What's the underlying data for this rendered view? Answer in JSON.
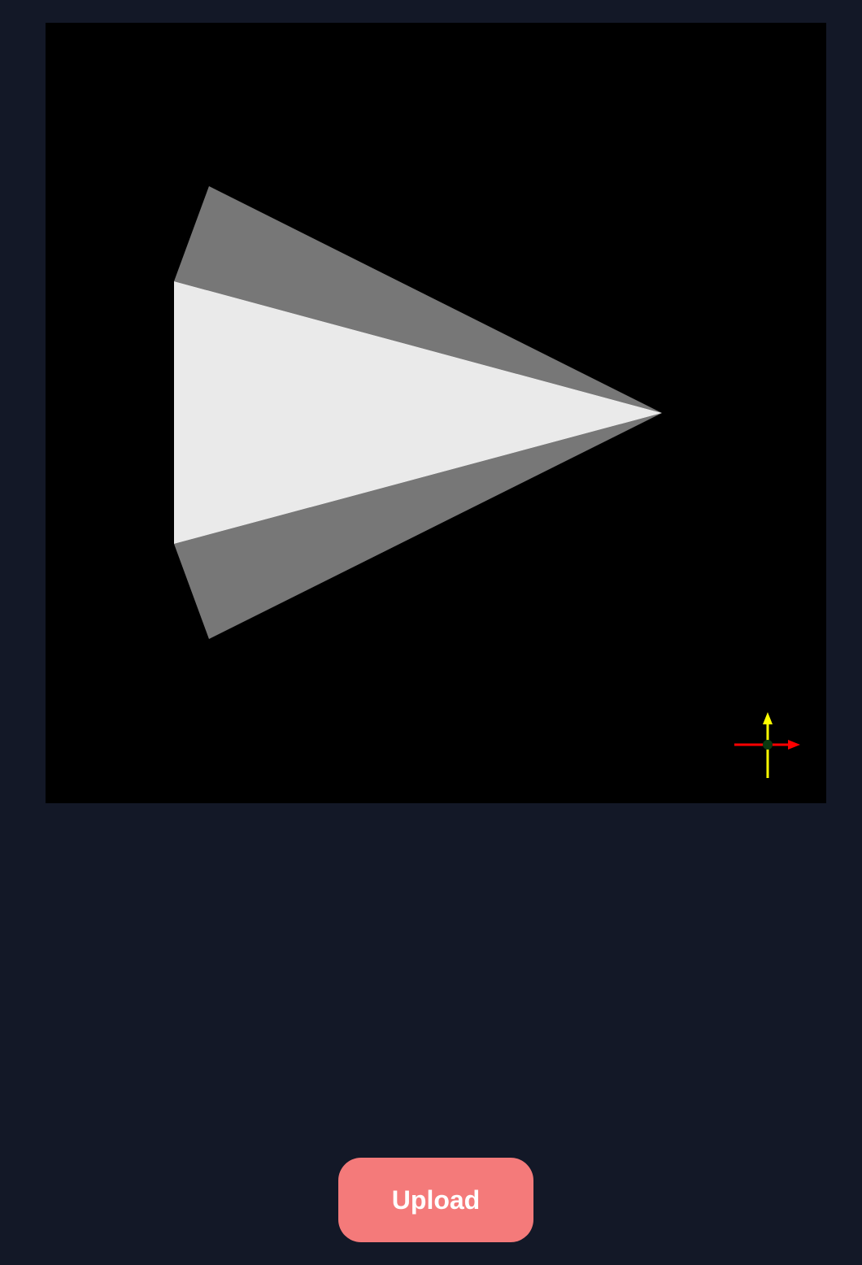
{
  "viewport": {
    "background": "#000000",
    "cone": {
      "front_face_color": "#EAEAEA",
      "side_face_color": "#777777"
    },
    "axes_gizmo": {
      "x_axis_color": "#FF0000",
      "y_axis_color": "#FFFF00",
      "origin_color": "#0B3A10"
    }
  },
  "upload_button": {
    "label": "Upload",
    "color": "#F47A7A"
  },
  "page": {
    "background": "#131827"
  }
}
